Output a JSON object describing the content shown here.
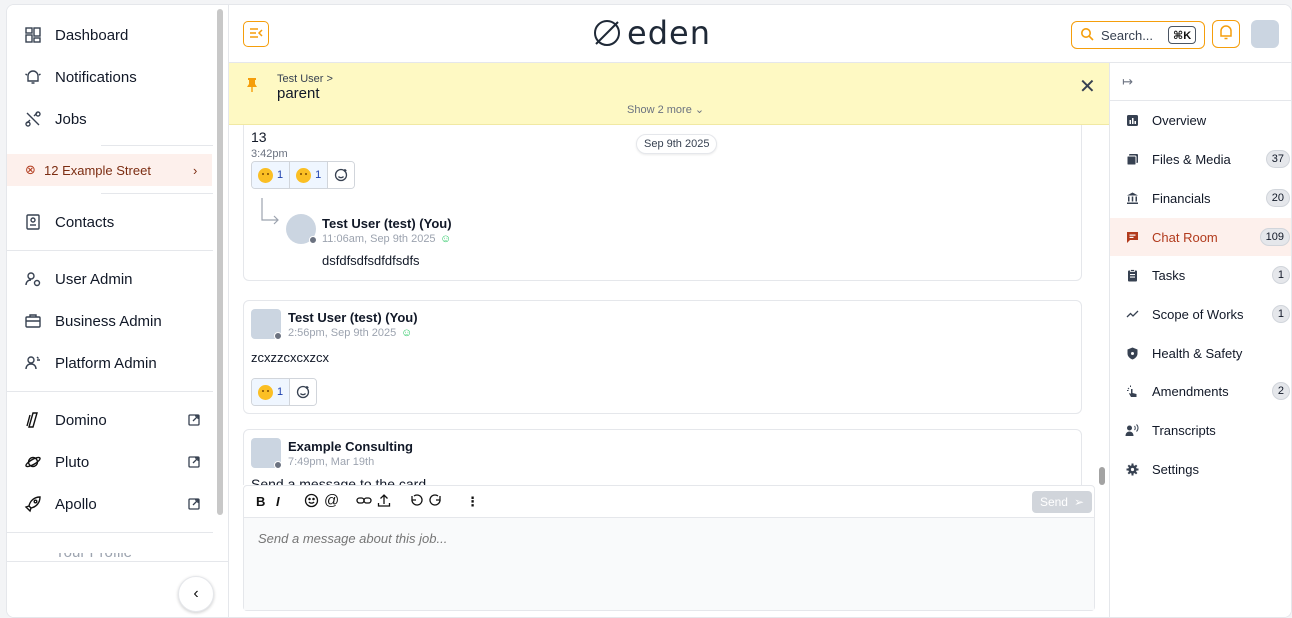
{
  "sidebar": {
    "items": [
      {
        "label": "Dashboard",
        "icon": "dashboard-icon"
      },
      {
        "label": "Notifications",
        "icon": "bell-icon"
      },
      {
        "label": "Jobs",
        "icon": "tools-icon"
      },
      {
        "label": "Contacts",
        "icon": "contact-card-icon"
      },
      {
        "label": "User Admin",
        "icon": "user-settings-icon"
      },
      {
        "label": "Business Admin",
        "icon": "briefcase-icon"
      },
      {
        "label": "Platform Admin",
        "icon": "platform-admin-icon"
      },
      {
        "label": "Domino",
        "icon": "domino-logo-icon"
      },
      {
        "label": "Pluto",
        "icon": "pluto-logo-icon"
      },
      {
        "label": "Apollo",
        "icon": "rocket-icon"
      }
    ],
    "active_job": "12 Example Street",
    "profile_label": "Your Profile"
  },
  "header": {
    "logo_text": "eden",
    "search_label": "Search...",
    "search_shortcut": "⌘K"
  },
  "pinned": {
    "crumb": "Test User >",
    "title": "parent",
    "show_more": "Show 2 more ⌄"
  },
  "messages": {
    "m1": {
      "text": "13",
      "time": "3:42pm",
      "date_pill": "Sep 9th 2025",
      "reactions": [
        {
          "count": "1"
        },
        {
          "count": "1"
        }
      ],
      "reply": {
        "author": "Test User (test) (You)",
        "time": "11:06am, Sep 9th 2025",
        "text": "dsfdfsdfsdfdfsdfs"
      }
    },
    "m2": {
      "author": "Test User (test) (You)",
      "time": "2:56pm, Sep 9th 2025",
      "text": "zcxzzcxcxzcx",
      "reactions": [
        {
          "count": "1"
        }
      ]
    },
    "m3": {
      "author": "Example Consulting",
      "time": "7:49pm, Mar 19th",
      "text": "Send a message to the card"
    }
  },
  "composer": {
    "placeholder": "Send a message about this job...",
    "send_label": "Send"
  },
  "right_panel": {
    "items": [
      {
        "label": "Overview",
        "badge": ""
      },
      {
        "label": "Files & Media",
        "badge": "37"
      },
      {
        "label": "Financials",
        "badge": "20"
      },
      {
        "label": "Chat Room",
        "badge": "109"
      },
      {
        "label": "Tasks",
        "badge": "1"
      },
      {
        "label": "Scope of Works",
        "badge": "1"
      },
      {
        "label": "Health & Safety",
        "badge": ""
      },
      {
        "label": "Amendments",
        "badge": "2"
      },
      {
        "label": "Transcripts",
        "badge": ""
      },
      {
        "label": "Settings",
        "badge": ""
      }
    ]
  },
  "colors": {
    "accent": "#f59e0b",
    "active_bg": "#fdf0ec",
    "active_text": "#b23b1d",
    "pinned_bg": "#fef9c3"
  }
}
